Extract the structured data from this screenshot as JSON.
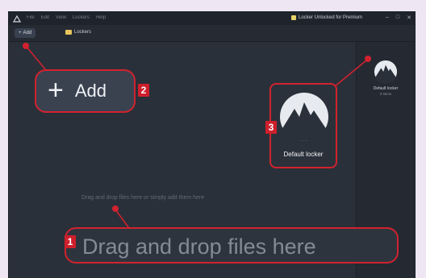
{
  "window": {
    "menu": [
      "File",
      "Edit",
      "View",
      "Lockers",
      "Help"
    ],
    "account_label": "Locker Unlocked for Premium",
    "controls": [
      "–",
      "□",
      "✕"
    ]
  },
  "toolbar": {
    "add_label": "Add",
    "crumb_label": "Lockers"
  },
  "side_panel": {
    "locker_name": "Default locker",
    "locker_sub": "0 items"
  },
  "main": {
    "drop_hint": "Drag and drop files here or simply add them here"
  },
  "callouts": {
    "add": {
      "number": "2",
      "label": "Add"
    },
    "locker": {
      "number": "3",
      "label": "Default locker"
    },
    "drag": {
      "number": "1",
      "label": "Drag and drop files here"
    }
  },
  "colors": {
    "accent_red": "#d1222f",
    "window_bg": "#2a3039",
    "page_bg": "#efe6f3"
  },
  "icons": [
    "app-logo-icon",
    "plus-icon",
    "folder-icon",
    "locker-mountain-icon"
  ]
}
